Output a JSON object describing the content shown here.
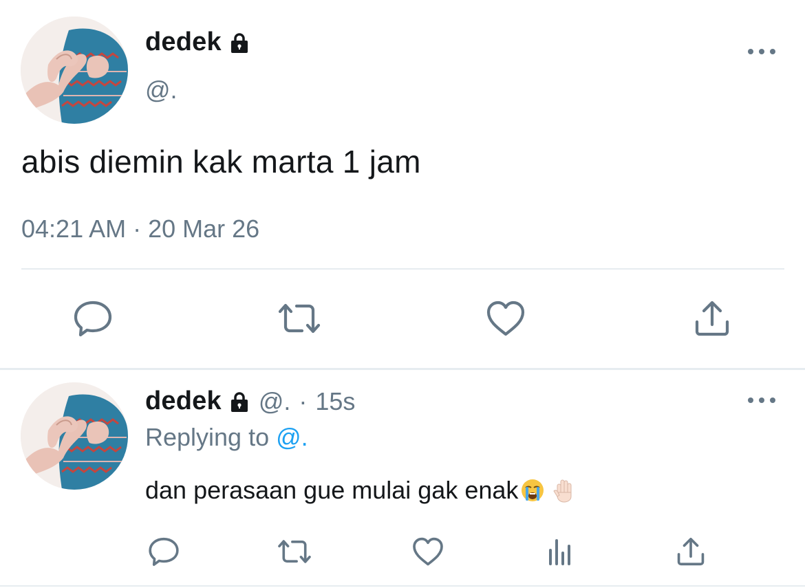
{
  "main_tweet": {
    "display_name": "dedek",
    "handle": "@.",
    "text": "abis diemin kak marta 1 jam",
    "timestamp": "04:21 AM · 20 Mar 26",
    "avatar_icon": "avatar-heart-hands",
    "actions": [
      "reply-icon",
      "retweet-icon",
      "like-icon",
      "share-icon"
    ]
  },
  "reply_tweet": {
    "display_name": "dedek",
    "handle": "@.",
    "separator": "·",
    "time_ago": "15s",
    "replying_to_label": "Replying to",
    "replying_to_handle": "@.",
    "text": "dan perasaan gue mulai gak enak",
    "emojis": [
      "loudly-crying-face",
      "raised-hand-light-skin"
    ],
    "actions": [
      "reply-icon",
      "retweet-icon",
      "like-icon",
      "analytics-icon",
      "share-icon"
    ]
  },
  "colors": {
    "text_primary": "#14171a",
    "text_secondary": "#657786",
    "link": "#1da1f2",
    "divider": "#e6ecf0"
  }
}
